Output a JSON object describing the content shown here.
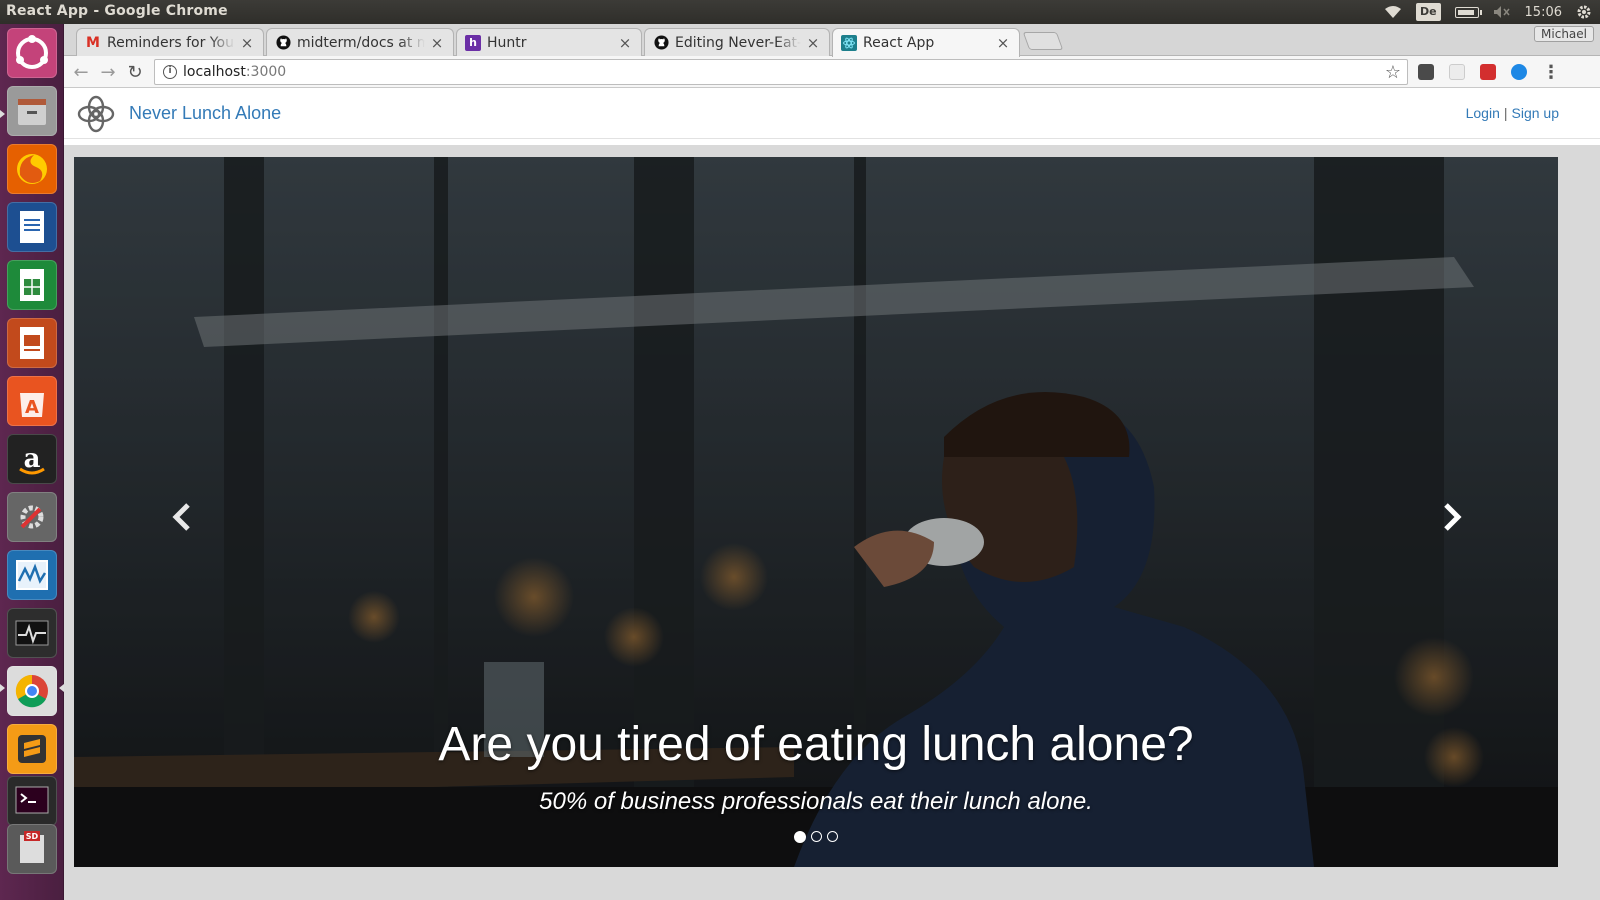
{
  "os": {
    "window_title": "React App - Google Chrome",
    "keyboard_layout": "De",
    "clock": "15:06"
  },
  "launcher": {
    "items": [
      {
        "name": "Ubuntu Dash"
      },
      {
        "name": "Files"
      },
      {
        "name": "Firefox"
      },
      {
        "name": "LibreOffice Writer"
      },
      {
        "name": "LibreOffice Calc"
      },
      {
        "name": "LibreOffice Impress"
      },
      {
        "name": "Ubuntu Software"
      },
      {
        "name": "Amazon"
      },
      {
        "name": "System Settings"
      },
      {
        "name": "Monitor"
      },
      {
        "name": "System Monitor"
      },
      {
        "name": "Google Chrome"
      },
      {
        "name": "Sublime Text"
      },
      {
        "name": "Terminal"
      },
      {
        "name": "SD Card"
      }
    ],
    "sd_label": "SD"
  },
  "browser": {
    "profile": "Michael",
    "tabs": [
      {
        "title": "Reminders for Your",
        "favicon": "gmail-icon",
        "favicon_text": "M",
        "color": "#d93025"
      },
      {
        "title": "midterm/docs at m",
        "favicon": "github-icon",
        "favicon_text": "",
        "color": "#111111"
      },
      {
        "title": "Huntr",
        "favicon": "huntr-icon",
        "favicon_text": "h",
        "color": "#6b2fa6"
      },
      {
        "title": "Editing Never-Eat-A",
        "favicon": "github-icon",
        "favicon_text": "",
        "color": "#111111"
      },
      {
        "title": "React App",
        "favicon": "react-icon",
        "favicon_text": "",
        "color": "#1d7f8c"
      }
    ],
    "active_tab": 4,
    "close_glyph": "×",
    "url_host": "localhost",
    "url_port": ":3000"
  },
  "app": {
    "brand": "Never Lunch Alone",
    "login": "Login",
    "separator": "|",
    "signup": "Sign up",
    "carousel": {
      "slide_count": 3,
      "active_slide": 1,
      "headline": "Are you tired of eating lunch alone?",
      "subline": "50% of business professionals eat their lunch alone."
    }
  },
  "colors": {
    "link": "#337ab7",
    "ubuntu_panel": "#3c3b37",
    "launcher": "#5e2750"
  }
}
